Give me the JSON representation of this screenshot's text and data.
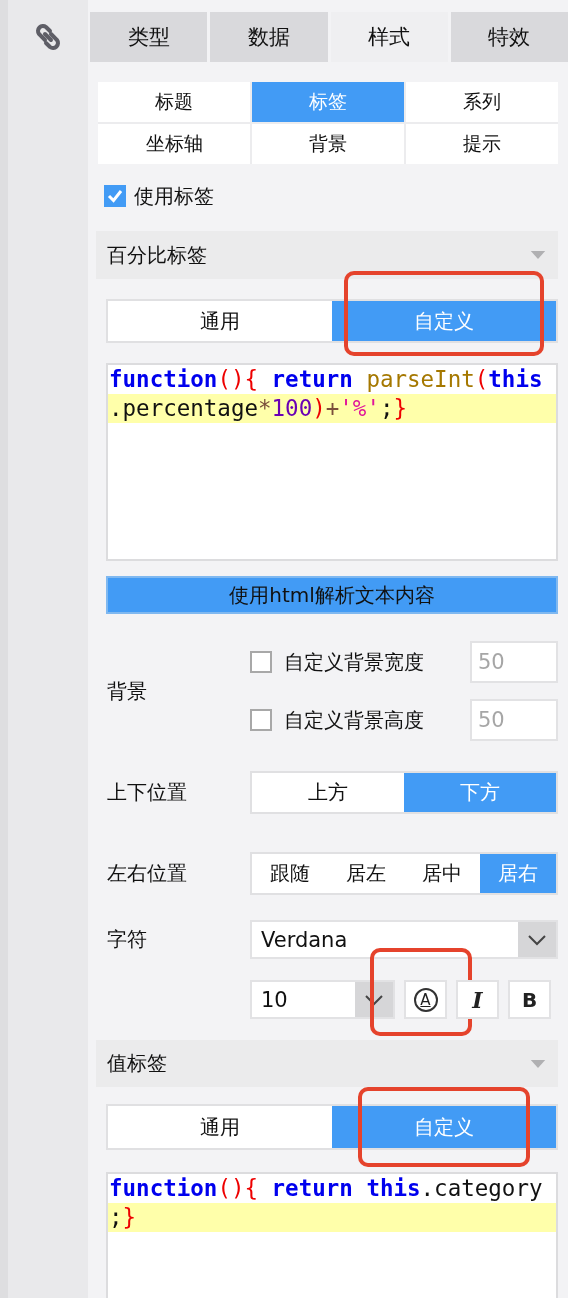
{
  "tabs": [
    {
      "label": "类型",
      "selected": false
    },
    {
      "label": "数据",
      "selected": false
    },
    {
      "label": "样式",
      "selected": true
    },
    {
      "label": "特效",
      "selected": false
    }
  ],
  "subtabs": [
    {
      "label": "标题",
      "selected": false
    },
    {
      "label": "标签",
      "selected": true
    },
    {
      "label": "系列",
      "selected": false
    },
    {
      "label": "坐标轴",
      "selected": false
    },
    {
      "label": "背景",
      "selected": false
    },
    {
      "label": "提示",
      "selected": false
    }
  ],
  "use_label": {
    "label": "使用标签",
    "checked": true
  },
  "percent_section": {
    "title": "百分比标签",
    "mode_options": [
      {
        "label": "通用",
        "selected": false,
        "highlighted": false
      },
      {
        "label": "自定义",
        "selected": true,
        "highlighted": true
      }
    ],
    "code": [
      {
        "highlighted": false,
        "tokens": [
          {
            "kind": "keyword",
            "text": "function"
          },
          {
            "kind": "bracket",
            "text": "(){"
          },
          {
            "kind": "keyword",
            "text": " return"
          },
          {
            "kind": "builtin",
            "text": " parseInt"
          },
          {
            "kind": "bracket",
            "text": "("
          },
          {
            "kind": "keyword",
            "text": "this"
          }
        ]
      },
      {
        "highlighted": true,
        "tokens": [
          {
            "kind": "plain",
            "text": ".percentage"
          },
          {
            "kind": "operator",
            "text": "*"
          },
          {
            "kind": "number",
            "text": "100"
          },
          {
            "kind": "bracket",
            "text": ")"
          },
          {
            "kind": "operator",
            "text": "+"
          },
          {
            "kind": "string",
            "text": "'%'"
          },
          {
            "kind": "plain",
            "text": ";"
          },
          {
            "kind": "bracket",
            "text": "}"
          }
        ]
      }
    ],
    "html_button": "使用html解析文本内容",
    "background": {
      "label": "背景",
      "rows": [
        {
          "label": "自定义背景宽度",
          "checked": false,
          "placeholder": "50"
        },
        {
          "label": "自定义背景高度",
          "checked": false,
          "placeholder": "50"
        }
      ]
    },
    "vertical": {
      "label": "上下位置",
      "options": [
        {
          "label": "上方",
          "selected": false
        },
        {
          "label": "下方",
          "selected": true
        }
      ]
    },
    "horizontal": {
      "label": "左右位置",
      "options": [
        {
          "label": "跟随",
          "selected": false
        },
        {
          "label": "居左",
          "selected": false
        },
        {
          "label": "居中",
          "selected": false
        },
        {
          "label": "居右",
          "selected": true
        }
      ]
    },
    "font": {
      "label": "字符",
      "family": "Verdana",
      "size": "10",
      "tools": [
        {
          "kind": "color",
          "label": "A",
          "highlighted": true
        },
        {
          "kind": "italic",
          "label": "I",
          "highlighted": false
        },
        {
          "kind": "bold",
          "label": "B",
          "highlighted": false
        }
      ]
    }
  },
  "value_section": {
    "title": "值标签",
    "mode_options": [
      {
        "label": "通用",
        "selected": false,
        "highlighted": false
      },
      {
        "label": "自定义",
        "selected": true,
        "highlighted": true
      }
    ],
    "code": [
      {
        "highlighted": false,
        "tokens": [
          {
            "kind": "keyword",
            "text": "function"
          },
          {
            "kind": "bracket",
            "text": "(){"
          },
          {
            "kind": "keyword",
            "text": " return"
          },
          {
            "kind": "keyword",
            "text": " this"
          },
          {
            "kind": "plain",
            "text": ".category"
          }
        ]
      },
      {
        "highlighted": true,
        "tokens": [
          {
            "kind": "plain",
            "text": ";"
          },
          {
            "kind": "bracket",
            "text": "}"
          }
        ]
      }
    ]
  }
}
